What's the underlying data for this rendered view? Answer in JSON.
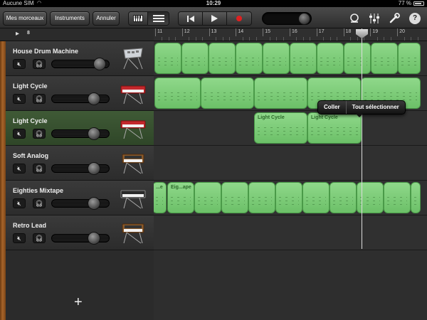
{
  "statusbar": {
    "carrier": "Aucune SIM",
    "time": "10:29",
    "battery": "77 %"
  },
  "toolbar": {
    "my_songs": "Mes morceaux",
    "instruments": "Instruments",
    "undo": "Annuler",
    "view_keyboard_icon": "keyboard-icon",
    "view_tracks_icon": "track-list-icon",
    "transport": [
      "rewind-icon",
      "play-icon",
      "record-icon"
    ],
    "right_icons": [
      "loop-icon",
      "mixer-icon",
      "wrench-icon",
      "help-icon"
    ],
    "help_label": "?"
  },
  "subbar": {
    "label": "8"
  },
  "ruler": {
    "bars": [
      "11",
      "12",
      "13",
      "14",
      "15",
      "16",
      "17",
      "18",
      "19",
      "20"
    ]
  },
  "tracks": [
    {
      "name": "House Drum Machine",
      "instrument": "drum-machine",
      "volume": 0.85
    },
    {
      "name": "Light Cycle",
      "instrument": "synth-red",
      "volume": 0.75
    },
    {
      "name": "Light Cycle",
      "instrument": "synth-red",
      "volume": 0.75,
      "selected": true
    },
    {
      "name": "Soft Analog",
      "instrument": "synth-wood",
      "volume": 0.75
    },
    {
      "name": "Eighties Mixtape",
      "instrument": "synth-black",
      "volume": 0.75
    },
    {
      "name": "Retro Lead",
      "instrument": "synth-wood",
      "volume": 0.75
    }
  ],
  "regions_labels": {
    "light_cycle": "Light Cycle",
    "eighties_short_1": "...e",
    "eighties_short_2": "Eig...ape"
  },
  "popover": {
    "paste": "Coller",
    "select_all": "Tout sélectionner"
  },
  "add_track": "+",
  "colors": {
    "region": "#78c874",
    "selected_track": "#3f5a36",
    "wood": "#a7652a"
  }
}
